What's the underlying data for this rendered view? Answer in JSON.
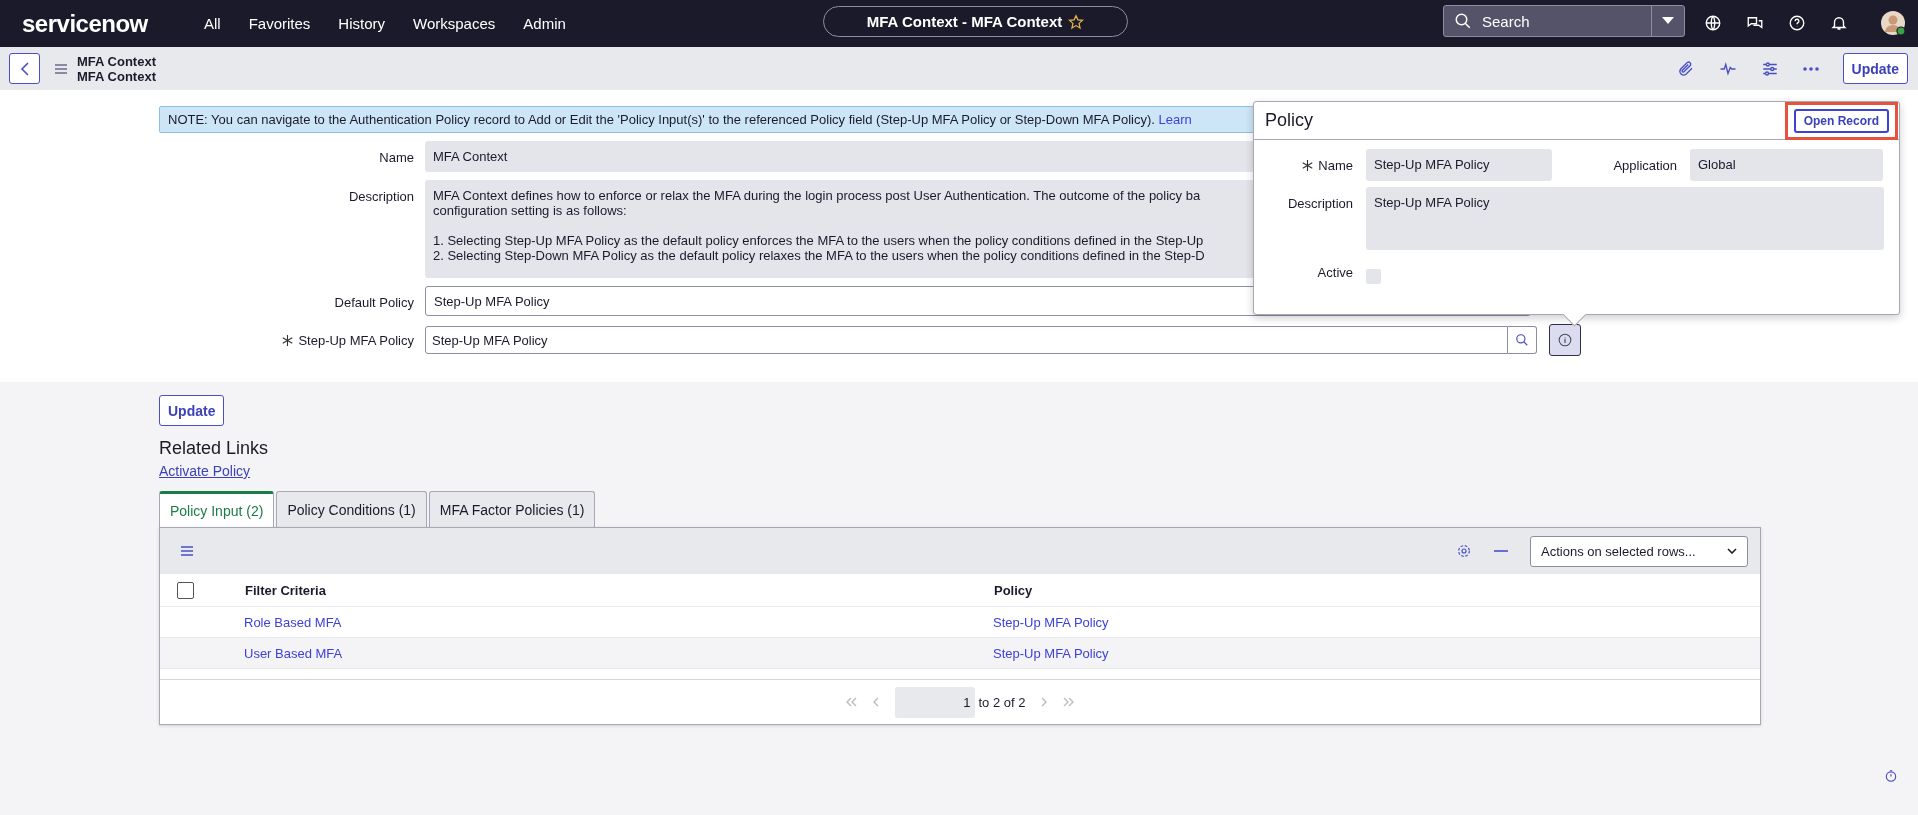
{
  "nav": {
    "logo": "servicenow",
    "menu": [
      "All",
      "Favorites",
      "History",
      "Workspaces",
      "Admin"
    ],
    "title": "MFA Context - MFA Context",
    "search": {
      "placeholder": "Search"
    }
  },
  "header": {
    "lines": [
      "MFA Context",
      "MFA Context"
    ],
    "update": "Update"
  },
  "note": {
    "text": "NOTE: You can navigate to the Authentication Policy record to Add or Edit the 'Policy Input(s)' to the referenced Policy field (Step-Up MFA Policy or Step-Down MFA Policy).",
    "link": "Learn"
  },
  "form": {
    "name": {
      "label": "Name",
      "value": "MFA Context"
    },
    "description": {
      "label": "Description",
      "paragraphs": [
        [
          "MFA Context defines how to enforce or relax the MFA during the login process post User Authentication. The outcome of the policy ba",
          "configuration setting is as follows:"
        ],
        [
          "1. Selecting Step-Up MFA Policy as the default policy enforces the MFA to the users when the policy conditions defined in the Step-Up",
          "2. Selecting Step-Down MFA Policy as the default policy relaxes the MFA to the users when the policy conditions defined in the Step-D"
        ]
      ]
    },
    "default_policy": {
      "label": "Default Policy",
      "value": "Step-Up MFA Policy"
    },
    "step_up": {
      "label": "Step-Up MFA Policy",
      "required": true,
      "value": "Step-Up MFA Policy"
    }
  },
  "popup": {
    "title": "Policy",
    "open_record": "Open Record",
    "highlighted": true,
    "name": {
      "label": "Name",
      "required": true,
      "value": "Step-Up MFA Policy"
    },
    "application": {
      "label": "Application",
      "value": "Global"
    },
    "description": {
      "label": "Description",
      "value": "Step-Up MFA Policy"
    },
    "active": {
      "label": "Active",
      "checked": false
    }
  },
  "update_button": "Update",
  "related_links": {
    "title": "Related Links",
    "links": [
      "Activate Policy"
    ]
  },
  "tabs": [
    {
      "label": "Policy Input (2)",
      "selected": true
    },
    {
      "label": "Policy Conditions (1)",
      "selected": false
    },
    {
      "label": "MFA Factor Policies (1)",
      "selected": false
    }
  ],
  "table": {
    "select_all": {
      "checked": false
    },
    "actions": "Actions on selected rows...",
    "columns": [
      "Filter Criteria",
      "Policy"
    ],
    "rows": [
      [
        "Role Based MFA",
        "Step-Up MFA Policy"
      ],
      [
        "User Based MFA",
        "Step-Up MFA Policy"
      ]
    ],
    "pager": {
      "page": "1",
      "range": "to 2 of 2"
    }
  }
}
